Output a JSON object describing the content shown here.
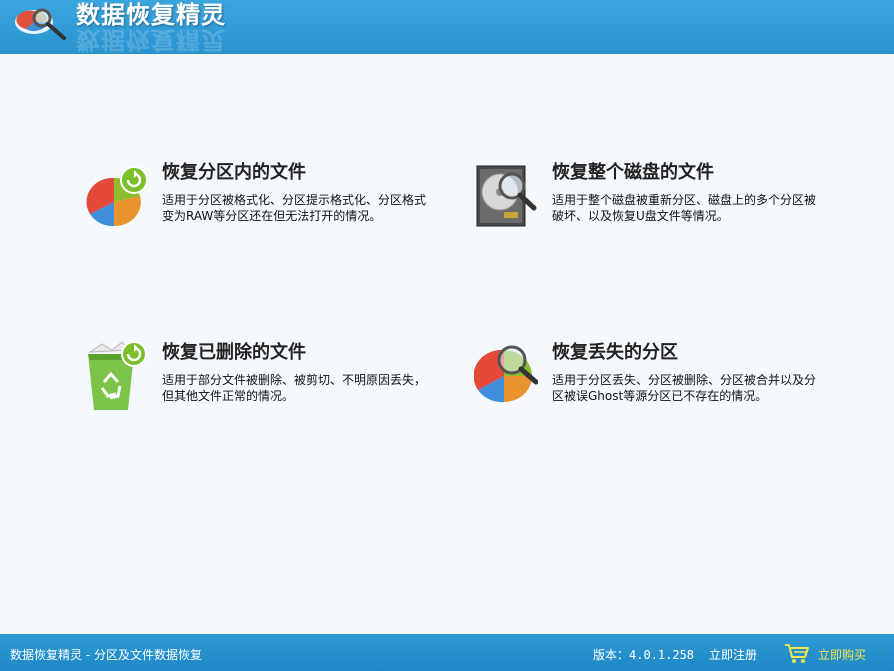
{
  "header": {
    "app_title": "数据恢复精灵",
    "logo_icon": "magnifier-pie-logo-icon"
  },
  "options": [
    {
      "title": "恢复分区内的文件",
      "desc": "适用于分区被格式化、分区提示格式化、分区格式变为RAW等分区还在但无法打开的情况。",
      "icon": "pie-refresh-icon"
    },
    {
      "title": "恢复整个磁盘的文件",
      "desc": "适用于整个磁盘被重新分区、磁盘上的多个分区被破坏、以及恢复U盘文件等情况。",
      "icon": "hard-disk-search-icon"
    },
    {
      "title": "恢复已删除的文件",
      "desc": "适用于部分文件被删除、被剪切、不明原因丢失，但其他文件正常的情况。",
      "icon": "recycle-bin-icon"
    },
    {
      "title": "恢复丢失的分区",
      "desc": "适用于分区丢失、分区被删除、分区被合并以及分区被误Ghost等源分区已不存在的情况。",
      "icon": "pie-search-icon"
    }
  ],
  "footer": {
    "product_text": "数据恢复精灵 - 分区及文件数据恢复",
    "version_text": "版本：4.0.1.258",
    "register_label": "立即注册",
    "buy_label": "立即购买",
    "cart_icon": "shopping-cart-icon"
  },
  "colors": {
    "header_bg": "#2a93d0",
    "content_bg": "#f5f9fd",
    "footer_bg": "#1f88c6",
    "buy_text": "#f5e64a"
  }
}
